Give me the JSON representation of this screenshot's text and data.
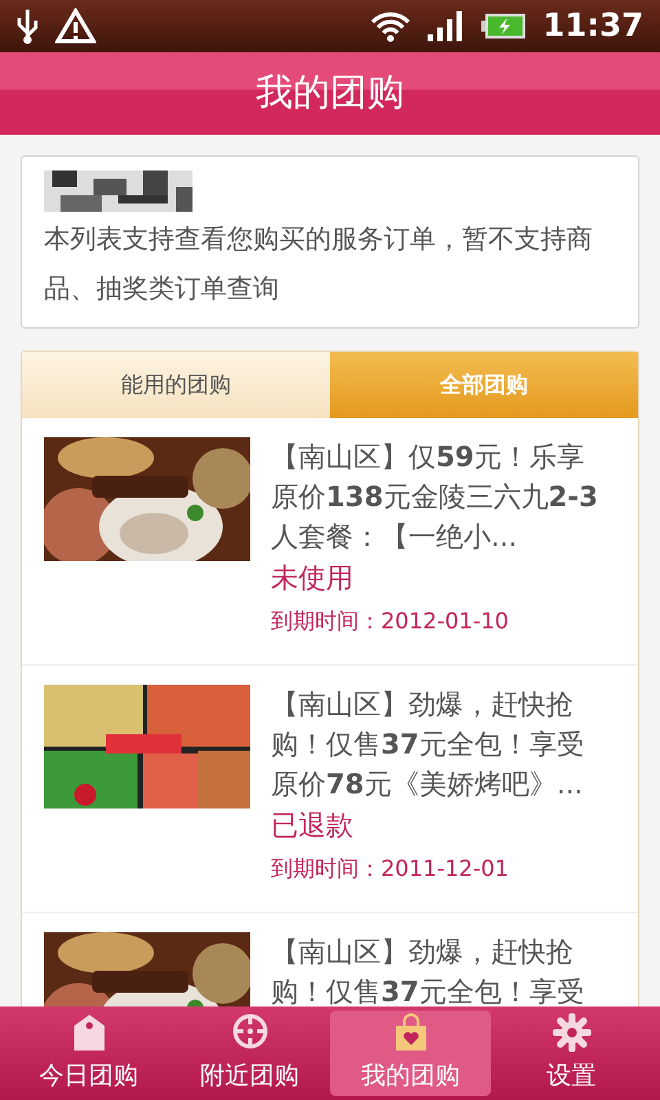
{
  "status_bar": {
    "time": "11:37"
  },
  "header": {
    "title": "我的团购"
  },
  "notice": {
    "text": "本列表支持查看您购买的服务订单，暂不支持商品、抽奖类订单查询"
  },
  "tabs": [
    {
      "label": "能用的团购",
      "selected": false
    },
    {
      "label": "全部团购",
      "selected": true
    }
  ],
  "deals": [
    {
      "title": "【南山区】仅**59**元！乐享原价**138**元金陵三六九**2-3**人套餐：【一绝小...",
      "status": "未使用",
      "expiry": "到期时间：2012-01-10"
    },
    {
      "title": "【南山区】劲爆，赶快抢购！仅售**37**元全包！享受原价**78**元《美娇烤吧》...",
      "status": "已退款",
      "expiry": "到期时间：2011-12-01"
    },
    {
      "title": "【南山区】劲爆，赶快抢购！仅售**37**元全包！享受"
    }
  ],
  "bottom_nav": [
    {
      "label": "今日团购",
      "selected": false
    },
    {
      "label": "附近团购",
      "selected": false
    },
    {
      "label": "我的团购",
      "selected": true
    },
    {
      "label": "设置",
      "selected": false
    }
  ]
}
